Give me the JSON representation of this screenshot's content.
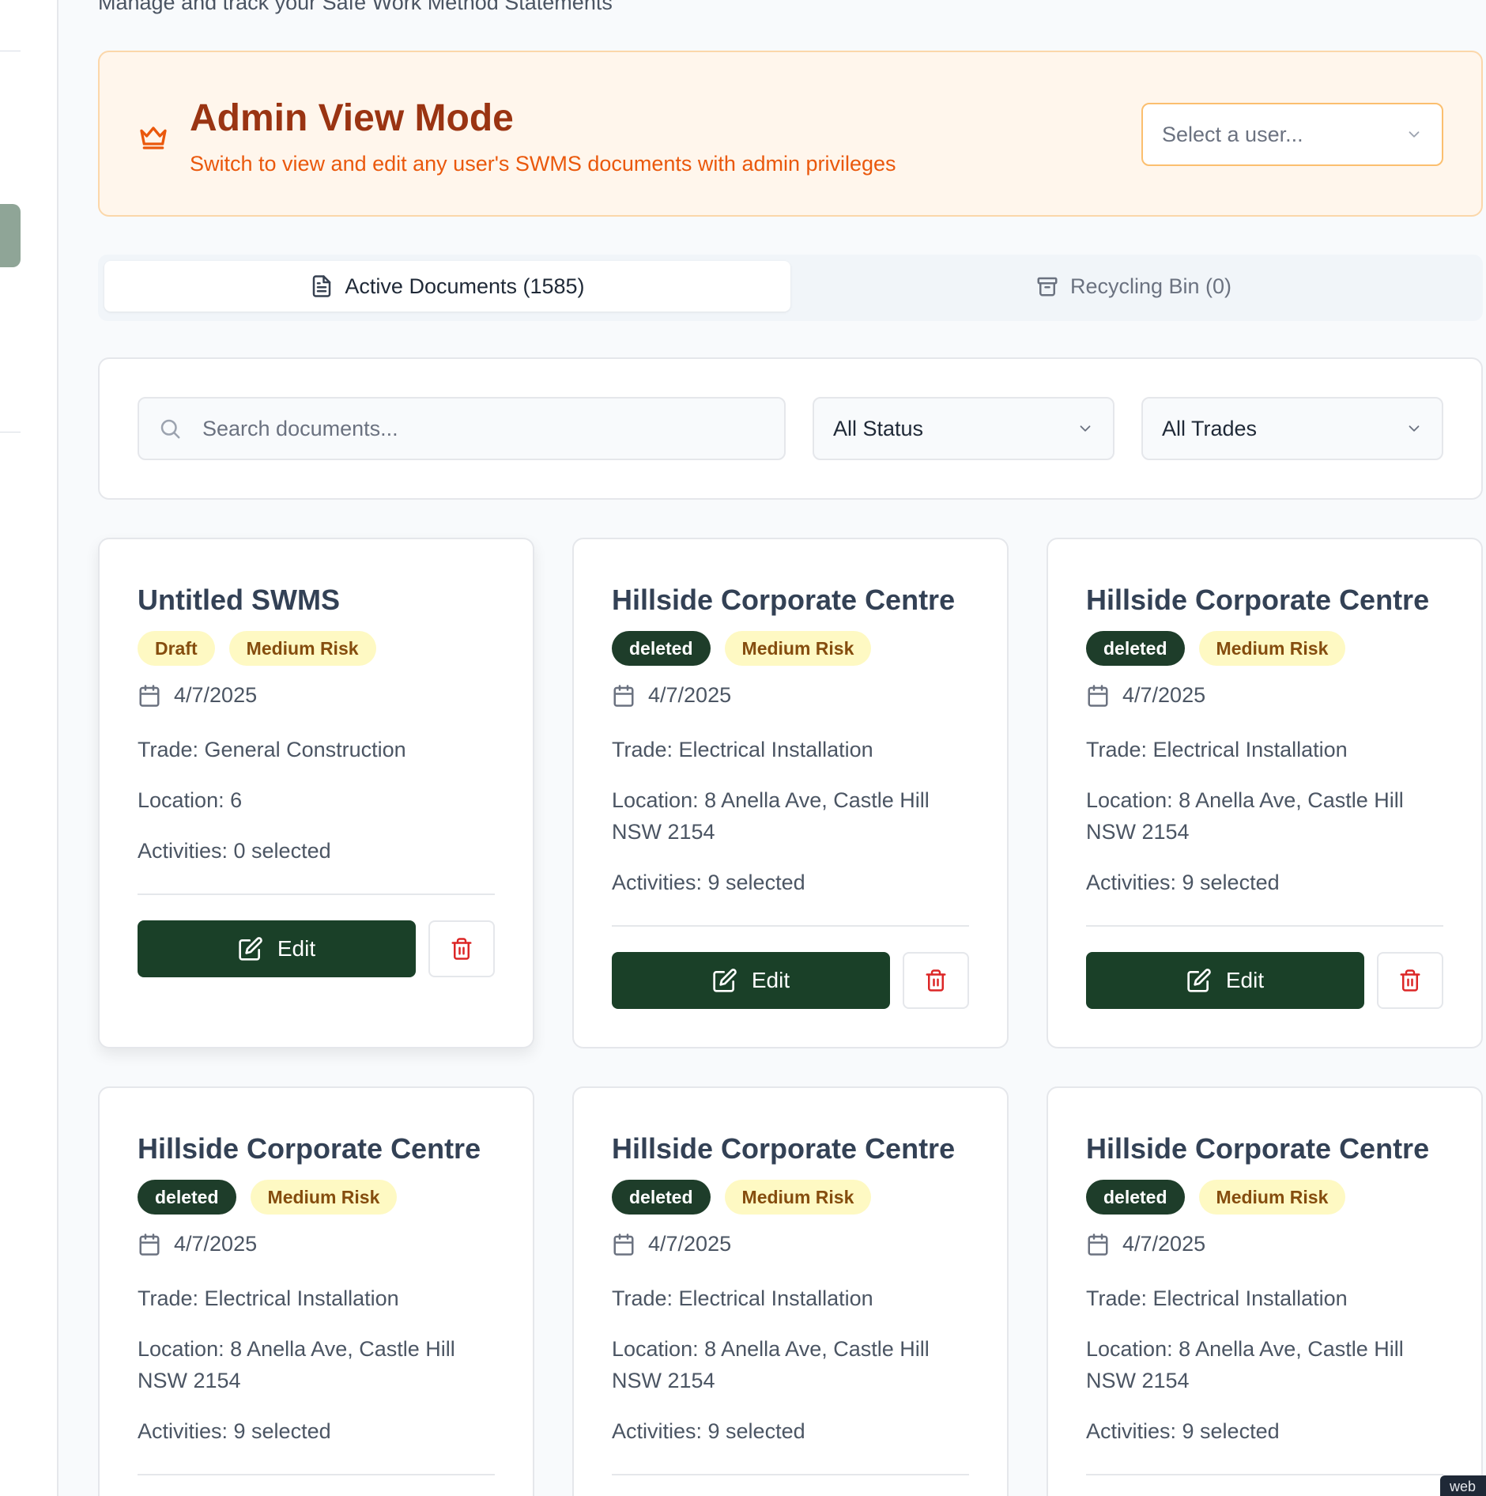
{
  "header": {
    "subtitle": "Manage and track your Safe Work Method Statements"
  },
  "admin": {
    "title": "Admin View Mode",
    "description": "Switch to view and edit any user's SWMS documents with admin privileges",
    "user_select_placeholder": "Select a user..."
  },
  "tabs": {
    "active_label": "Active Documents (1585)",
    "bin_label": "Recycling Bin (0)"
  },
  "filters": {
    "search_placeholder": "Search documents...",
    "status_value": "All Status",
    "trades_value": "All Trades"
  },
  "cards": [
    {
      "title": "Untitled SWMS",
      "status": "Draft",
      "risk": "Medium Risk",
      "date": "4/7/2025",
      "trade": "Trade: General Construction",
      "location": "Location: 6",
      "activities": "Activities: 0 selected",
      "edit": "Edit"
    },
    {
      "title": "Hillside Corporate Centre",
      "status": "deleted",
      "risk": "Medium Risk",
      "date": "4/7/2025",
      "trade": "Trade: Electrical Installation",
      "location": "Location: 8 Anella Ave, Castle Hill NSW 2154",
      "activities": "Activities: 9 selected",
      "edit": "Edit"
    },
    {
      "title": "Hillside Corporate Centre",
      "status": "deleted",
      "risk": "Medium Risk",
      "date": "4/7/2025",
      "trade": "Trade: Electrical Installation",
      "location": "Location: 8 Anella Ave, Castle Hill NSW 2154",
      "activities": "Activities: 9 selected",
      "edit": "Edit"
    },
    {
      "title": "Hillside Corporate Centre",
      "status": "deleted",
      "risk": "Medium Risk",
      "date": "4/7/2025",
      "trade": "Trade: Electrical Installation",
      "location": "Location: 8 Anella Ave, Castle Hill NSW 2154",
      "activities": "Activities: 9 selected"
    },
    {
      "title": "Hillside Corporate Centre",
      "status": "deleted",
      "risk": "Medium Risk",
      "date": "4/7/2025",
      "trade": "Trade: Electrical Installation",
      "location": "Location: 8 Anella Ave, Castle Hill NSW 2154",
      "activities": "Activities: 9 selected"
    },
    {
      "title": "Hillside Corporate Centre",
      "status": "deleted",
      "risk": "Medium Risk",
      "date": "4/7/2025",
      "trade": "Trade: Electrical Installation",
      "location": "Location: 8 Anella Ave, Castle Hill NSW 2154",
      "activities": "Activities: 9 selected"
    }
  ],
  "corner_tag": "web",
  "colors": {
    "primary": "#1a4028",
    "admin_bg": "#fff6ec",
    "admin_title": "#9a3412",
    "admin_text": "#ea580c",
    "badge_yellow": "#fef9c3",
    "danger": "#dc2626"
  },
  "icons": {
    "admin": "crown-icon",
    "active_tab": "document-icon",
    "bin_tab": "archive-icon",
    "search": "search-icon",
    "dropdown": "chevron-down-icon",
    "date": "calendar-icon",
    "edit": "edit-icon",
    "delete": "trash-icon"
  }
}
